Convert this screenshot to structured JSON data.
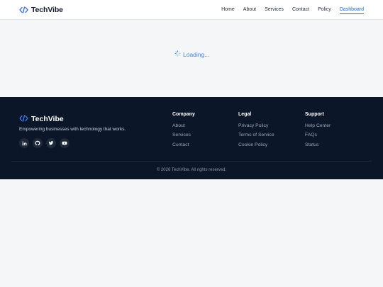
{
  "brand": {
    "name": "TechVibe",
    "icon": "code-icon"
  },
  "nav": {
    "items": [
      {
        "label": "Home"
      },
      {
        "label": "About"
      },
      {
        "label": "Services"
      },
      {
        "label": "Contact"
      },
      {
        "label": "Policy"
      },
      {
        "label": "Dashboard",
        "active": true
      }
    ]
  },
  "main": {
    "loading_text": "Loading...",
    "loading_icon": "spinner-icon"
  },
  "footer": {
    "brand_name": "TechVibe",
    "tagline": "Empowering businesses with technology that works.",
    "socials": [
      "linkedin-icon",
      "github-icon",
      "twitter-icon",
      "youtube-icon"
    ],
    "columns": [
      {
        "title": "Company",
        "links": [
          "About",
          "Services",
          "Contact"
        ]
      },
      {
        "title": "Legal",
        "links": [
          "Privacy Policy",
          "Terms of Service",
          "Cookie Policy"
        ]
      },
      {
        "title": "Support",
        "links": [
          "Help Center",
          "FAQs",
          "Status"
        ]
      }
    ],
    "copyright": "© 2026 TechVibe. All rights reserved."
  },
  "colors": {
    "accent": "#2563eb",
    "footer_bg": "#0b1628",
    "page_bg": "#f5f6f8"
  }
}
